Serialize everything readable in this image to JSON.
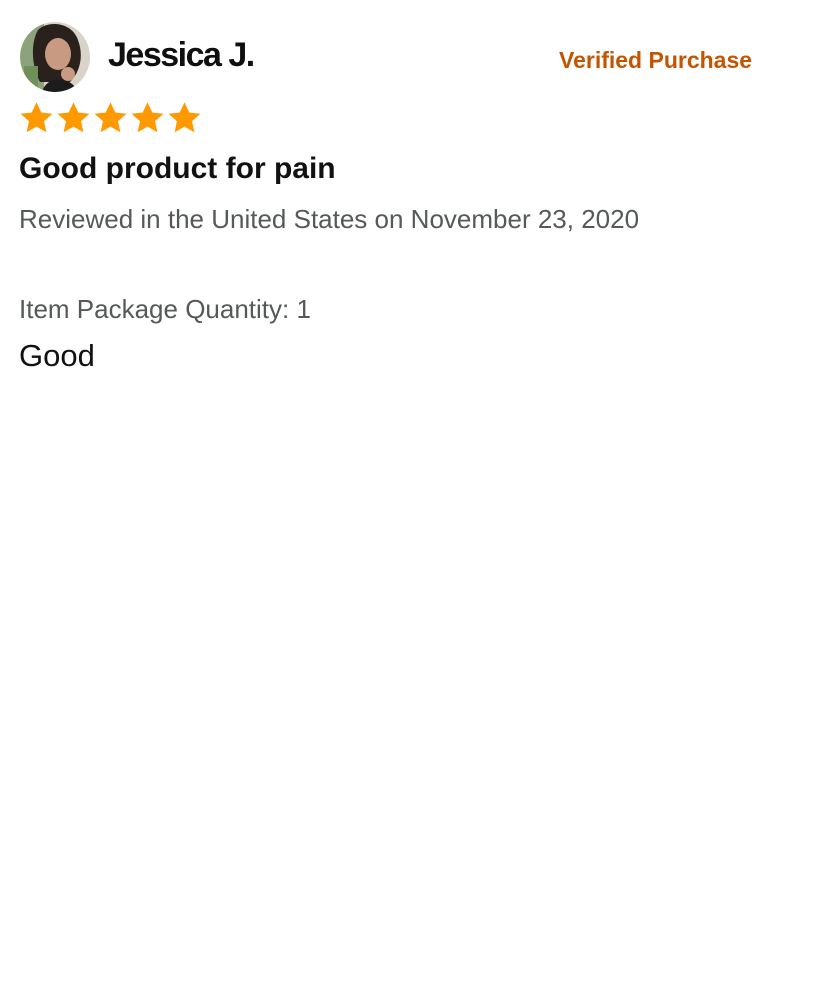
{
  "review": {
    "reviewer_name": "Jessica J.",
    "badge": "Verified Purchase",
    "rating": 5,
    "rating_max": 5,
    "title": "Good product for pain",
    "reviewed_line": "Reviewed in the United States on November 23, 2020",
    "package_quantity": "Item Package Quantity: 1",
    "body": "Good"
  },
  "colors": {
    "badge": "#c45500",
    "star": "#ff9900",
    "meta_text": "#565959",
    "text": "#111111"
  },
  "icons": {
    "avatar": "reviewer-avatar-photo",
    "star": "star-icon"
  }
}
